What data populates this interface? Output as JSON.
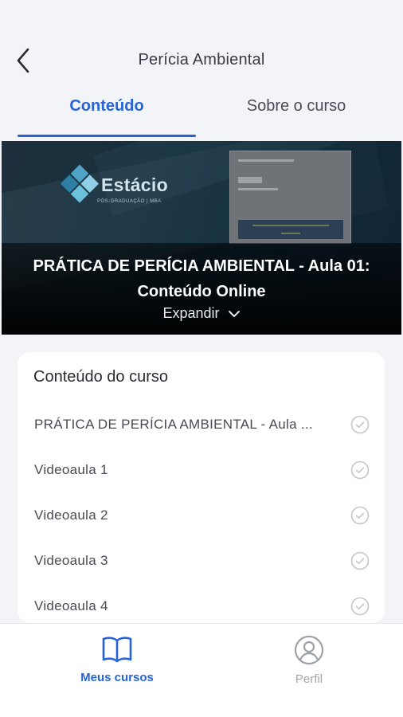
{
  "header": {
    "title": "Perícia Ambiental",
    "back_icon": "chevron-left-icon"
  },
  "tabs": [
    {
      "label": "Conteúdo",
      "active": true
    },
    {
      "label": "Sobre o curso",
      "active": false
    }
  ],
  "video": {
    "logo_text": "Estácio",
    "logo_subtext": "PÓS-GRADUAÇÃO | MBA",
    "title": "PRÁTICA DE PERÍCIA AMBIENTAL - Aula 01: Conteúdo Online",
    "expand_label": "Expandir",
    "expand_icon": "chevron-down-icon"
  },
  "course_content": {
    "title": "Conteúdo do curso",
    "items": [
      {
        "label": "PRÁTICA DE PERÍCIA AMBIENTAL - Aula ...",
        "status_icon": "check-circle-icon"
      },
      {
        "label": "Videoaula 1",
        "status_icon": "check-circle-icon"
      },
      {
        "label": "Videoaula 2",
        "status_icon": "check-circle-icon"
      },
      {
        "label": "Videoaula 3",
        "status_icon": "check-circle-icon"
      },
      {
        "label": "Videoaula 4",
        "status_icon": "check-circle-icon"
      }
    ]
  },
  "bottom_nav": {
    "items": [
      {
        "label": "Meus cursos",
        "icon": "book-icon",
        "active": true
      },
      {
        "label": "Perfil",
        "icon": "user-circle-icon",
        "active": false
      }
    ]
  },
  "colors": {
    "accent": "#2563d6",
    "background": "#f3f4f7",
    "inactive": "#a3a5ad",
    "check": "#c5c6cc"
  }
}
